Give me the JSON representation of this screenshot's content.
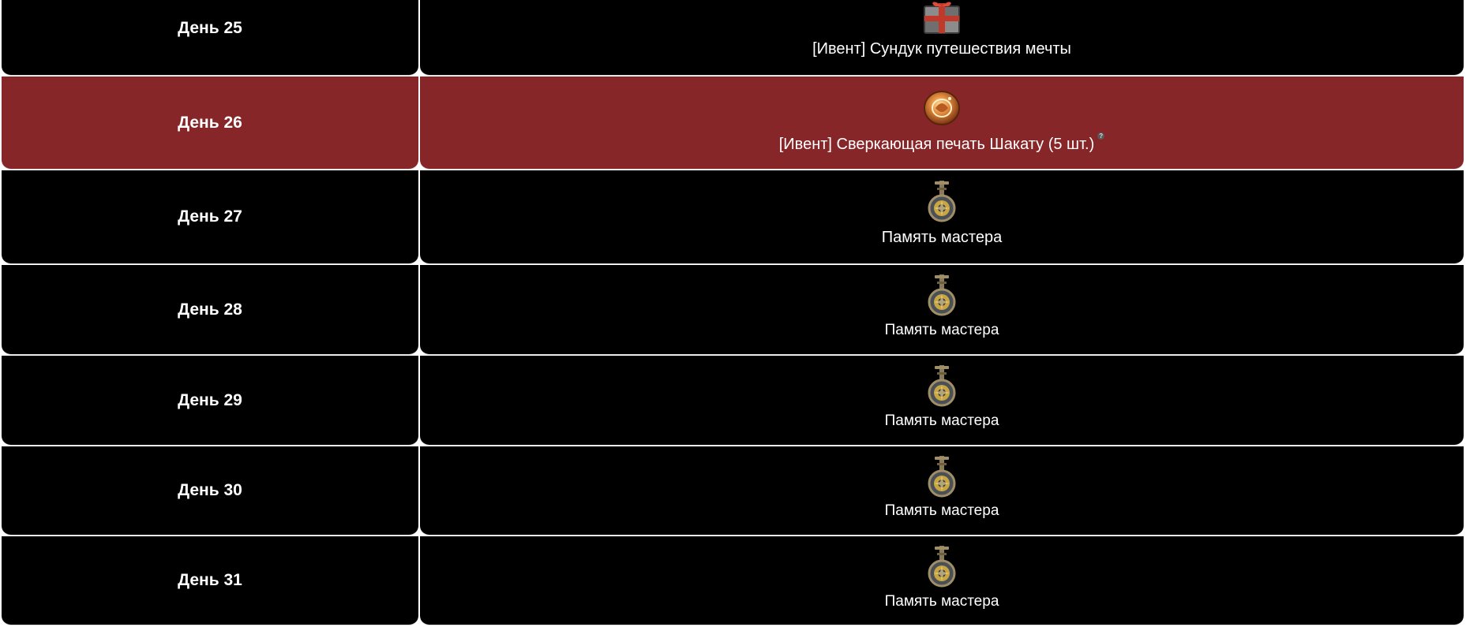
{
  "rows": [
    {
      "day": "День 25",
      "item": "[Ивент] Сундук путешествия мечты",
      "icon": "gift-chest-icon",
      "highlight": false
    },
    {
      "day": "День 26",
      "item": "[Ивент] Сверкающая печать Шакату (5 шт.)",
      "icon": "seal-icon",
      "help": "?",
      "highlight": true
    },
    {
      "day": "День 27",
      "item": "Память мастера",
      "icon": "master-memory-icon",
      "highlight": false
    },
    {
      "day": "День 28",
      "item": "Память мастера",
      "icon": "master-memory-icon",
      "highlight": false
    },
    {
      "day": "День 29",
      "item": "Память мастера",
      "icon": "master-memory-icon",
      "highlight": false
    },
    {
      "day": "День 30",
      "item": "Память мастера",
      "icon": "master-memory-icon",
      "highlight": false
    },
    {
      "day": "День 31",
      "item": "Память мастера",
      "icon": "master-memory-icon",
      "highlight": false
    }
  ],
  "colors": {
    "row_background": "#000000",
    "highlight_background": "#872628",
    "text": "#ffffff"
  }
}
